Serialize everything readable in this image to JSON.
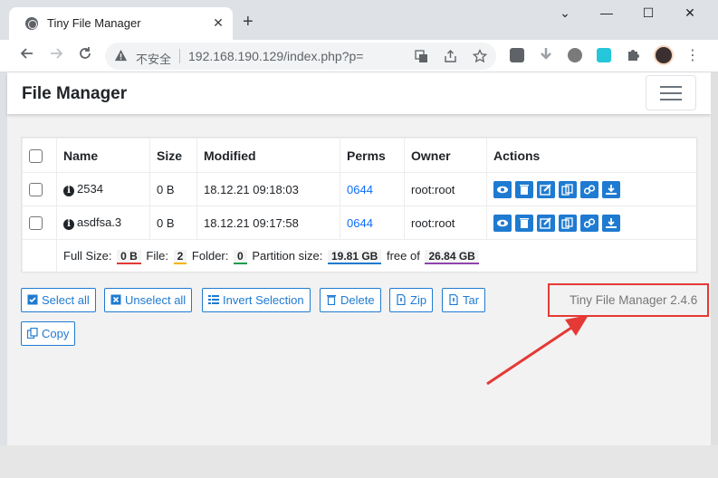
{
  "browser": {
    "tab_title": "Tiny File Manager",
    "tab_close": "✕",
    "new_tab": "+",
    "win_minimize": "⌄",
    "win_min": "—",
    "win_max": "☐",
    "win_close": "✕",
    "insecure_label": "不安全",
    "url": "192.168.190.129/index.php?p=",
    "menu_dots": "⋮"
  },
  "app": {
    "brand": "File Manager"
  },
  "table": {
    "headers": [
      "Name",
      "Size",
      "Modified",
      "Perms",
      "Owner",
      "Actions"
    ],
    "rows": [
      {
        "name": "2534",
        "size": "0 B",
        "modified": "18.12.21 09:18:03",
        "perms": "0644",
        "owner": "root:root"
      },
      {
        "name": "asdfsa.3",
        "size": "0 B",
        "modified": "18.12.21 09:17:58",
        "perms": "0644",
        "owner": "root:root"
      }
    ],
    "footer": {
      "full_size_label": "Full Size:",
      "full_size": "0 B",
      "file_label": "File:",
      "file_count": "2",
      "folder_label": "Folder:",
      "folder_count": "0",
      "partition_label": "Partition size:",
      "partition_size": "19.81 GB",
      "free_label": "free of",
      "total_size": "26.84 GB"
    }
  },
  "buttons": {
    "select_all": "Select all",
    "unselect_all": "Unselect all",
    "invert": "Invert Selection",
    "delete": "Delete",
    "zip": "Zip",
    "tar": "Tar",
    "copy": "Copy"
  },
  "version": "Tiny File Manager 2.4.6",
  "colors": {
    "accent": "#1f7bd1",
    "annotation": "#e53935"
  }
}
